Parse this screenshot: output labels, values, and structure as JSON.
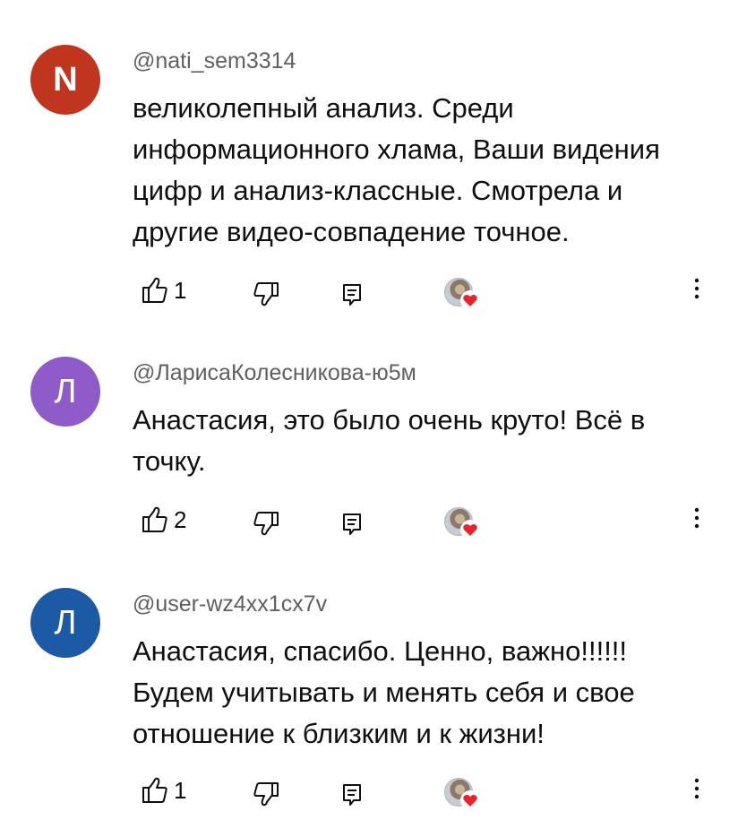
{
  "comments": [
    {
      "avatar_letter": "N",
      "avatar_color": "#c0351d",
      "author": "@nati_sem3314",
      "text_lines": [
        "великолепный анализ. Среди",
        "информационного хлама, Ваши видения",
        "цифр и анализ-классные. Смотрела и",
        "другие видео-совпадение точное."
      ],
      "likes": "1",
      "creator_hearted": true
    },
    {
      "avatar_letter": "Л",
      "avatar_color": "#8e5bc9",
      "author": "@ЛарисаКолесникова-ю5м",
      "text_lines": [
        "Анастасия, это было очень круто! Всё в",
        "точку."
      ],
      "likes": "2",
      "creator_hearted": true
    },
    {
      "avatar_letter": "Л",
      "avatar_color": "#1c5aa6",
      "author": "@user-wz4xx1cx7v",
      "text_lines": [
        "Анастасия, спасибо. Ценно, важно!!!!!!",
        "Будем учитывать и менять себя и свое",
        "отношение к близким и к жизни!"
      ],
      "likes": "1",
      "creator_hearted": true
    }
  ],
  "icons": {
    "like": "thumbs-up-icon",
    "dislike": "thumbs-down-icon",
    "reply": "reply-icon",
    "heart": "creator-heart-icon",
    "more": "more-vert-icon"
  },
  "colors": {
    "heart": "#e8232c",
    "author_text": "#606060",
    "body_text": "#0f0f0f"
  }
}
